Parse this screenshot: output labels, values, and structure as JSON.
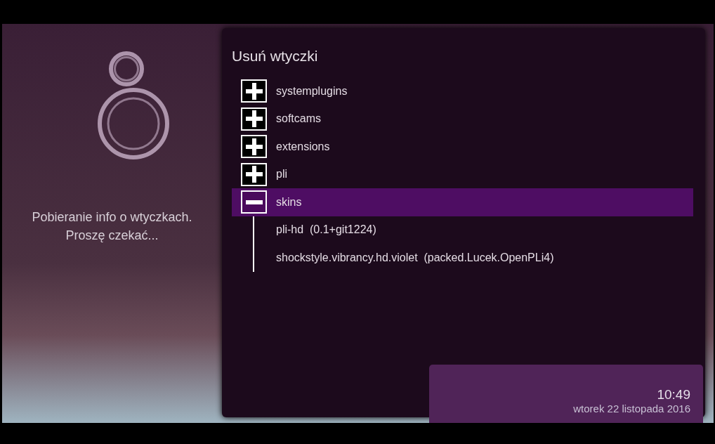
{
  "side_message": "Pobieranie info o wtyczkach.\nProszę czekać...",
  "panel": {
    "title": "Usuń wtyczki",
    "items": [
      {
        "label": "systemplugins",
        "expanded": false,
        "selected": false
      },
      {
        "label": "softcams",
        "expanded": false,
        "selected": false
      },
      {
        "label": "extensions",
        "expanded": false,
        "selected": false
      },
      {
        "label": "pli",
        "expanded": false,
        "selected": false
      },
      {
        "label": "skins",
        "expanded": true,
        "selected": true,
        "children": [
          {
            "label": "pli-hd  (0.1+git1224)"
          },
          {
            "label": "shockstyle.vibrancy.hd.violet  (packed.Lucek.OpenPLi4)"
          }
        ]
      }
    ]
  },
  "clock": {
    "time": "10:49",
    "date": "wtorek 22 listopada 2016"
  }
}
